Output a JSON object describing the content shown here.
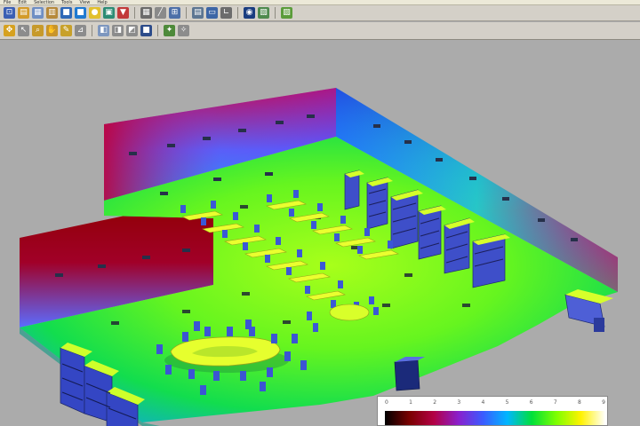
{
  "menu": {
    "items": [
      "File",
      "Edit",
      "Selection",
      "Tools",
      "View",
      "Help"
    ]
  },
  "toolbar1": {
    "buttons": [
      {
        "name": "select-tool",
        "glyph": "⊡",
        "color": "#3b5fb4"
      },
      {
        "name": "open-file",
        "glyph": "▤",
        "color": "#d39b2a"
      },
      {
        "name": "save-file",
        "glyph": "▦",
        "color": "#6f8fc4"
      },
      {
        "name": "print",
        "glyph": "▥",
        "color": "#b6893b"
      },
      {
        "name": "model-a",
        "glyph": "■",
        "color": "#2e68b7"
      },
      {
        "name": "model-b",
        "glyph": "■",
        "color": "#1f7ad1"
      },
      {
        "name": "light-bulb",
        "glyph": "●",
        "color": "#e2c02d"
      },
      {
        "name": "material",
        "glyph": "▣",
        "color": "#2c8c75"
      },
      {
        "name": "luminaire",
        "glyph": "▼",
        "color": "#c23a3a"
      },
      {
        "name": "grid-view",
        "glyph": "▦",
        "color": "#6b6b6b"
      },
      {
        "name": "measure",
        "glyph": "╱",
        "color": "#8a8a8a"
      },
      {
        "name": "render-settings",
        "glyph": "⊞",
        "color": "#4d6fa8"
      },
      {
        "name": "table-view",
        "glyph": "▤",
        "color": "#5d7692"
      },
      {
        "name": "monitor",
        "glyph": "▭",
        "color": "#3d66a6"
      },
      {
        "name": "chart",
        "glyph": "∟",
        "color": "#6c6c6c"
      },
      {
        "name": "globe",
        "glyph": "◉",
        "color": "#1a3d80"
      },
      {
        "name": "export-image",
        "glyph": "▧",
        "color": "#4e8a4e"
      },
      {
        "name": "import-image",
        "glyph": "▨",
        "color": "#5b9c3a"
      }
    ]
  },
  "toolbar2": {
    "buttons": [
      {
        "name": "move-tool",
        "glyph": "✥",
        "color": "#d6a11f"
      },
      {
        "name": "pointer-tool",
        "glyph": "↖",
        "color": "#8c8c8c"
      },
      {
        "name": "zoom-tool",
        "glyph": "⌕",
        "color": "#c79a2a"
      },
      {
        "name": "pan-tool",
        "glyph": "✋",
        "color": "#c8952a"
      },
      {
        "name": "draw-tool",
        "glyph": "✎",
        "color": "#c8a12a"
      },
      {
        "name": "measure-tool",
        "glyph": "⊿",
        "color": "#8c8c8c"
      },
      {
        "name": "view-front",
        "glyph": "◧",
        "color": "#7d97bf"
      },
      {
        "name": "view-side",
        "glyph": "◨",
        "color": "#8c8c8c"
      },
      {
        "name": "view-top",
        "glyph": "◩",
        "color": "#8c8c8c"
      },
      {
        "name": "view-3d",
        "glyph": "■",
        "color": "#2d4c8a"
      },
      {
        "name": "light-on",
        "glyph": "✦",
        "color": "#4e8a3a"
      },
      {
        "name": "light-off",
        "glyph": "✧",
        "color": "#8c8c8c"
      }
    ]
  },
  "legend": {
    "tick_labels": [
      "0",
      "1",
      "2",
      "3",
      "4",
      "5",
      "6",
      "7",
      "8",
      "9"
    ],
    "gradient": [
      "#000000",
      "#7a0000",
      "#b30045",
      "#8a1fcc",
      "#3b5bff",
      "#00b6ff",
      "#00e03a",
      "#7dff00",
      "#fff200",
      "#ffffff"
    ]
  },
  "colors": {
    "background": "#ababab",
    "floor_center": "#8eff1a",
    "floor_edge": "#00d955",
    "wall_top": "#b30030",
    "wall_bottom": "#3f6cff",
    "furniture": "#3c5bd8",
    "table_top": "#e7ff2d"
  }
}
